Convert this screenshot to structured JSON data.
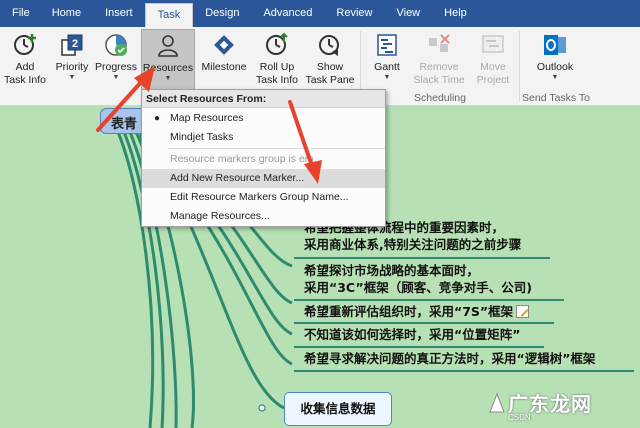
{
  "tabs": [
    {
      "label": "File",
      "active": false
    },
    {
      "label": "Home",
      "active": false
    },
    {
      "label": "Insert",
      "active": false
    },
    {
      "label": "Task",
      "active": true
    },
    {
      "label": "Design",
      "active": false
    },
    {
      "label": "Advanced",
      "active": false
    },
    {
      "label": "Review",
      "active": false
    },
    {
      "label": "View",
      "active": false
    },
    {
      "label": "Help",
      "active": false
    }
  ],
  "ribbon": {
    "add_task_info": {
      "line1": "Add",
      "line2": "Task Info",
      "icon": "add-task-info-icon"
    },
    "priority": {
      "label": "Priority",
      "icon": "priority-icon"
    },
    "progress": {
      "label": "Progress",
      "icon": "progress-icon"
    },
    "resources": {
      "label": "Resources",
      "icon": "person-icon",
      "pressed": true
    },
    "milestone": {
      "label": "Milestone",
      "icon": "milestone-icon"
    },
    "roll_up": {
      "line1": "Roll Up",
      "line2": "Task Info",
      "icon": "roll-up-icon"
    },
    "show_task_pane": {
      "line1": "Show",
      "line2": "Task Pane",
      "icon": "show-task-pane-icon"
    },
    "gantt": {
      "label": "Gantt",
      "icon": "gantt-icon"
    },
    "remove_slack": {
      "line1": "Remove",
      "line2": "Slack Time",
      "icon": "remove-slack-icon",
      "disabled": true
    },
    "move_project": {
      "line1": "Move",
      "line2": "Project",
      "icon": "move-project-icon",
      "disabled": true
    },
    "outlook": {
      "label": "Outlook",
      "icon": "outlook-icon"
    },
    "groups": {
      "scheduling": "Scheduling",
      "send_tasks_to": "Send Tasks To"
    }
  },
  "dropdown": {
    "header": "Select Resources From:",
    "items": [
      {
        "label": "Map Resources",
        "selected": true,
        "disabled": false
      },
      {
        "label": "Mindjet Tasks",
        "selected": false,
        "disabled": false
      },
      {
        "label": "Resource markers group is em",
        "selected": false,
        "disabled": true
      },
      {
        "label": "Add New Resource Marker...",
        "selected": false,
        "disabled": false,
        "hover": true
      },
      {
        "label": "Edit Resource Markers Group Name...",
        "selected": false,
        "disabled": false
      },
      {
        "label": "Manage Resources...",
        "selected": false,
        "disabled": false
      }
    ]
  },
  "map": {
    "central_topic_partial": "表青",
    "subtopics": [
      {
        "line1": "希望把握整体流程中的重要因素时，",
        "line2": "采用商业体系,特别关注问题的之前步骤"
      },
      {
        "line1": "希望探讨市场战略的基本面时，",
        "line2": "采用“3C”框架（顾客、竞争对手、公司)"
      },
      {
        "line1": "希望重新评估组织时，采用“7S”框架"
      },
      {
        "line1": "不知道该如何选择时，采用“位置矩阵”"
      },
      {
        "line1": "希望寻求解决问题的真正方法时，采用“逻辑树”框架"
      }
    ],
    "collect_topic": "收集信息数据"
  },
  "watermark": {
    "text": "广东龙网",
    "sub": "CSDN"
  },
  "colors": {
    "tab_bar": "#2b579a",
    "canvas": "#b7e1b5",
    "branch": "#2e8b6e",
    "arrow": "#e8412c"
  }
}
